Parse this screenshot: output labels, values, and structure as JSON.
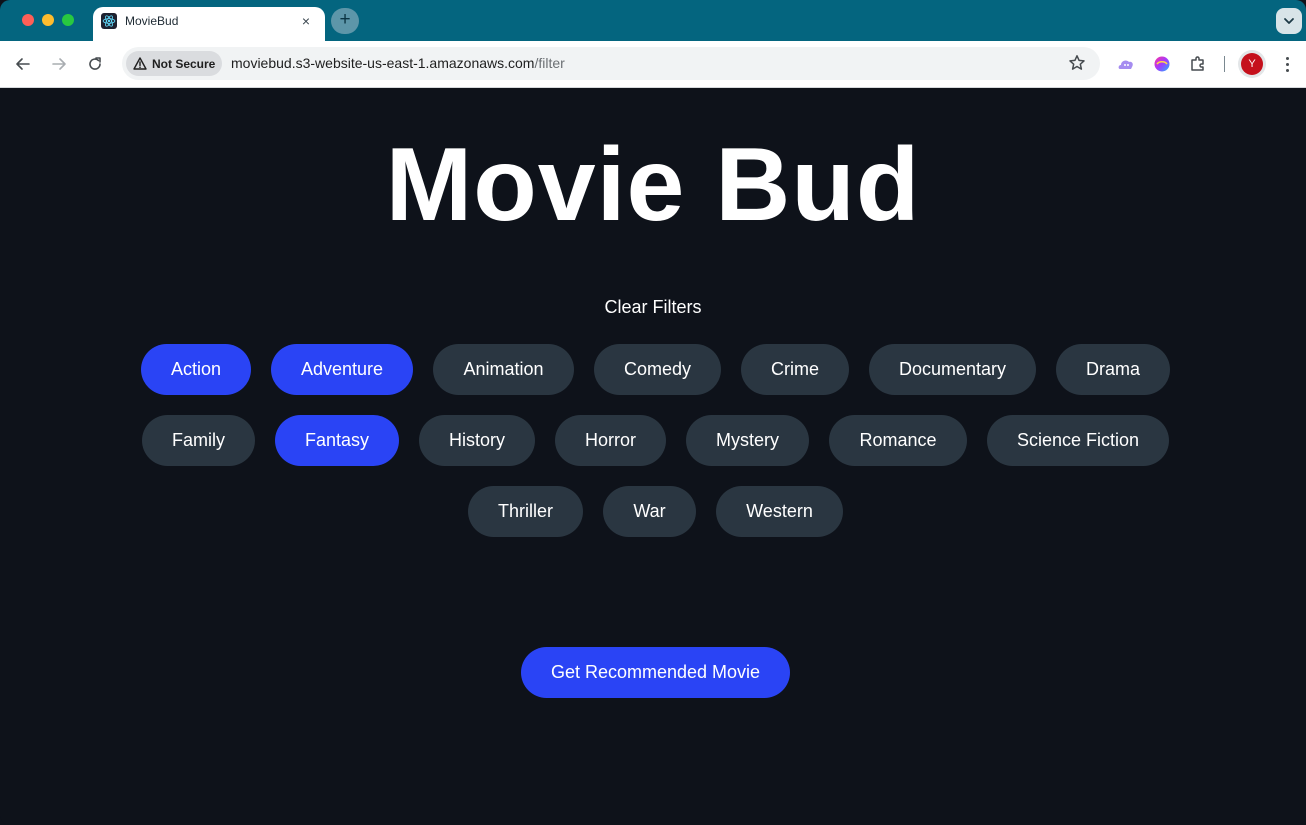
{
  "browser": {
    "tab_title": "MovieBud",
    "security_label": "Not Secure",
    "url_host": "moviebud.s3-website-us-east-1.amazonaws.com",
    "url_path": "/filter",
    "avatar_letter": "Y",
    "tab_close_glyph": "×",
    "new_tab_glyph": "+"
  },
  "page": {
    "title": "Movie Bud",
    "clear_filters": "Clear Filters",
    "cta": "Get Recommended Movie",
    "genres": [
      {
        "label": "Action",
        "selected": true
      },
      {
        "label": "Adventure",
        "selected": true
      },
      {
        "label": "Animation",
        "selected": false
      },
      {
        "label": "Comedy",
        "selected": false
      },
      {
        "label": "Crime",
        "selected": false
      },
      {
        "label": "Documentary",
        "selected": false
      },
      {
        "label": "Drama",
        "selected": false
      },
      {
        "label": "Family",
        "selected": false
      },
      {
        "label": "Fantasy",
        "selected": true
      },
      {
        "label": "History",
        "selected": false
      },
      {
        "label": "Horror",
        "selected": false
      },
      {
        "label": "Mystery",
        "selected": false
      },
      {
        "label": "Romance",
        "selected": false
      },
      {
        "label": "Science Fiction",
        "selected": false
      },
      {
        "label": "Thriller",
        "selected": false
      },
      {
        "label": "War",
        "selected": false
      },
      {
        "label": "Western",
        "selected": false
      }
    ]
  },
  "colors": {
    "page_bg": "#0e121a",
    "chip_default": "#2a3641",
    "chip_selected": "#2a44f5",
    "tabbar": "#04657f"
  },
  "icons": {
    "tab_favicon": "react-atom-icon",
    "security": "warning-triangle-icon",
    "bookmark": "star-outline-icon",
    "extension_1": "cloud-extension-icon",
    "extension_2": "gradient-orb-extension-icon",
    "extensions_menu": "puzzle-icon"
  }
}
